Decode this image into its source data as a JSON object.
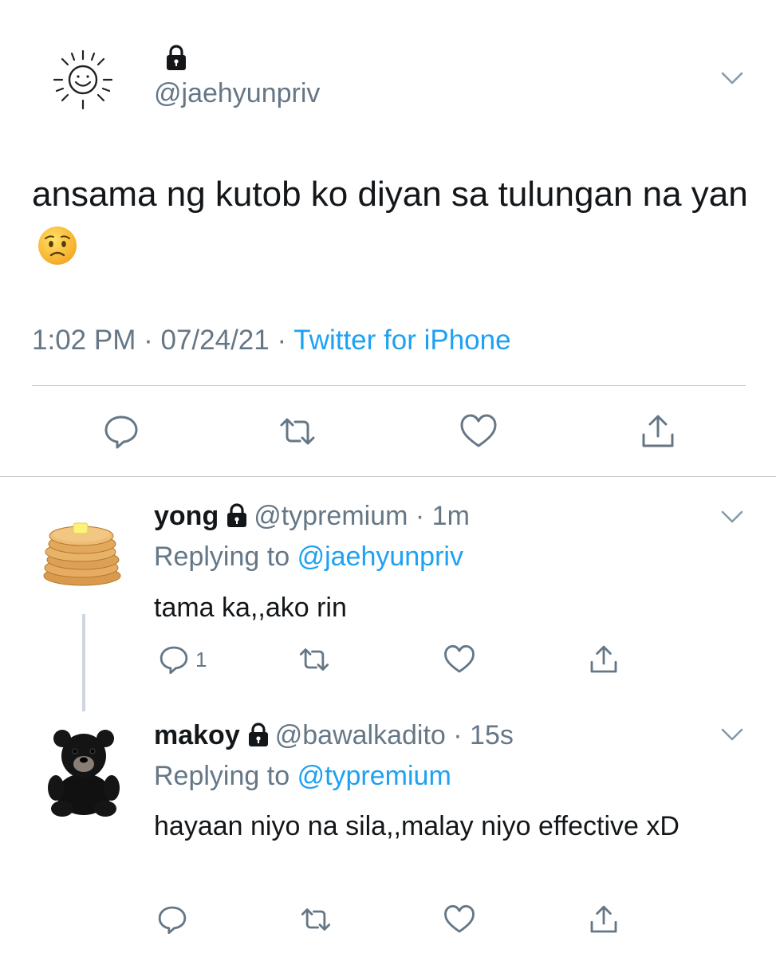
{
  "main_tweet": {
    "avatar_icon": "sun-doodle-icon",
    "lock_icon": "lock-icon",
    "handle": "@jaehyunpriv",
    "text": "ansama ng kutob ko diyan sa tulungan na yan",
    "emoji": "worried-face-emoji",
    "time": "1:02 PM",
    "date": "07/24/21",
    "separator": "·",
    "source": "Twitter for iPhone",
    "actions": [
      "reply-icon",
      "retweet-icon",
      "like-icon",
      "share-icon"
    ]
  },
  "replies": [
    {
      "avatar": "pancakes-avatar",
      "name": "yong",
      "handle": "@typremium",
      "time": "1m",
      "separator": "·",
      "replying_label": "Replying to",
      "replying_to": "@jaehyunpriv",
      "text": "tama ka,,ako rin",
      "reply_count": "1"
    },
    {
      "avatar": "black-teddy-bear-avatar",
      "name": "makoy",
      "handle": "@bawalkadito",
      "time": "15s",
      "separator": "·",
      "replying_label": "Replying to",
      "replying_to": "@typremium",
      "text": "hayaan niyo na sila,,malay niyo effective xD"
    }
  ],
  "colors": {
    "text": "#14171a",
    "secondary": "#657786",
    "link": "#1da1f2",
    "divider": "#c7ccd1"
  }
}
